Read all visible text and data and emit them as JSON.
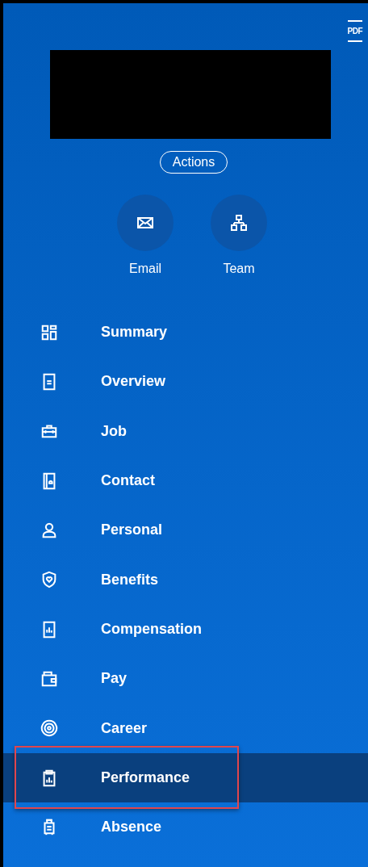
{
  "header": {
    "pdf_label": "PDF",
    "actions_label": "Actions"
  },
  "quick_actions": [
    {
      "label": "Email"
    },
    {
      "label": "Team"
    }
  ],
  "nav": [
    {
      "label": "Summary",
      "selected": false,
      "highlighted": false
    },
    {
      "label": "Overview",
      "selected": false,
      "highlighted": false
    },
    {
      "label": "Job",
      "selected": false,
      "highlighted": false
    },
    {
      "label": "Contact",
      "selected": false,
      "highlighted": false
    },
    {
      "label": "Personal",
      "selected": false,
      "highlighted": false
    },
    {
      "label": "Benefits",
      "selected": false,
      "highlighted": false
    },
    {
      "label": "Compensation",
      "selected": false,
      "highlighted": false
    },
    {
      "label": "Pay",
      "selected": false,
      "highlighted": false
    },
    {
      "label": "Career",
      "selected": false,
      "highlighted": false
    },
    {
      "label": "Performance",
      "selected": true,
      "highlighted": true
    },
    {
      "label": "Absence",
      "selected": false,
      "highlighted": false
    }
  ]
}
